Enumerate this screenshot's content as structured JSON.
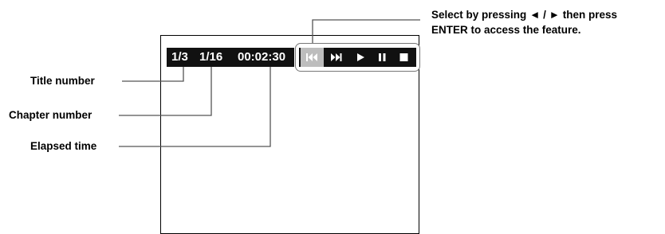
{
  "osd": {
    "title_counter": "1/3",
    "chapter_counter": "1/16",
    "elapsed_time": "00:02:30"
  },
  "controls": [
    {
      "name": "skip-back-icon",
      "selected": true
    },
    {
      "name": "skip-forward-icon",
      "selected": false
    },
    {
      "name": "play-icon",
      "selected": false
    },
    {
      "name": "pause-icon",
      "selected": false
    },
    {
      "name": "stop-icon",
      "selected": false
    }
  ],
  "callouts": {
    "title_number": "Title number",
    "chapter_number": "Chapter number",
    "elapsed_time": "Elapsed time"
  },
  "instruction": {
    "line1": "Select by pressing ◄ / ► then press",
    "line2": "ENTER  to access the  feature."
  },
  "colors": {
    "osd_background": "#111111",
    "selected_button": "#bdbdbd",
    "group_outline": "#777777"
  }
}
